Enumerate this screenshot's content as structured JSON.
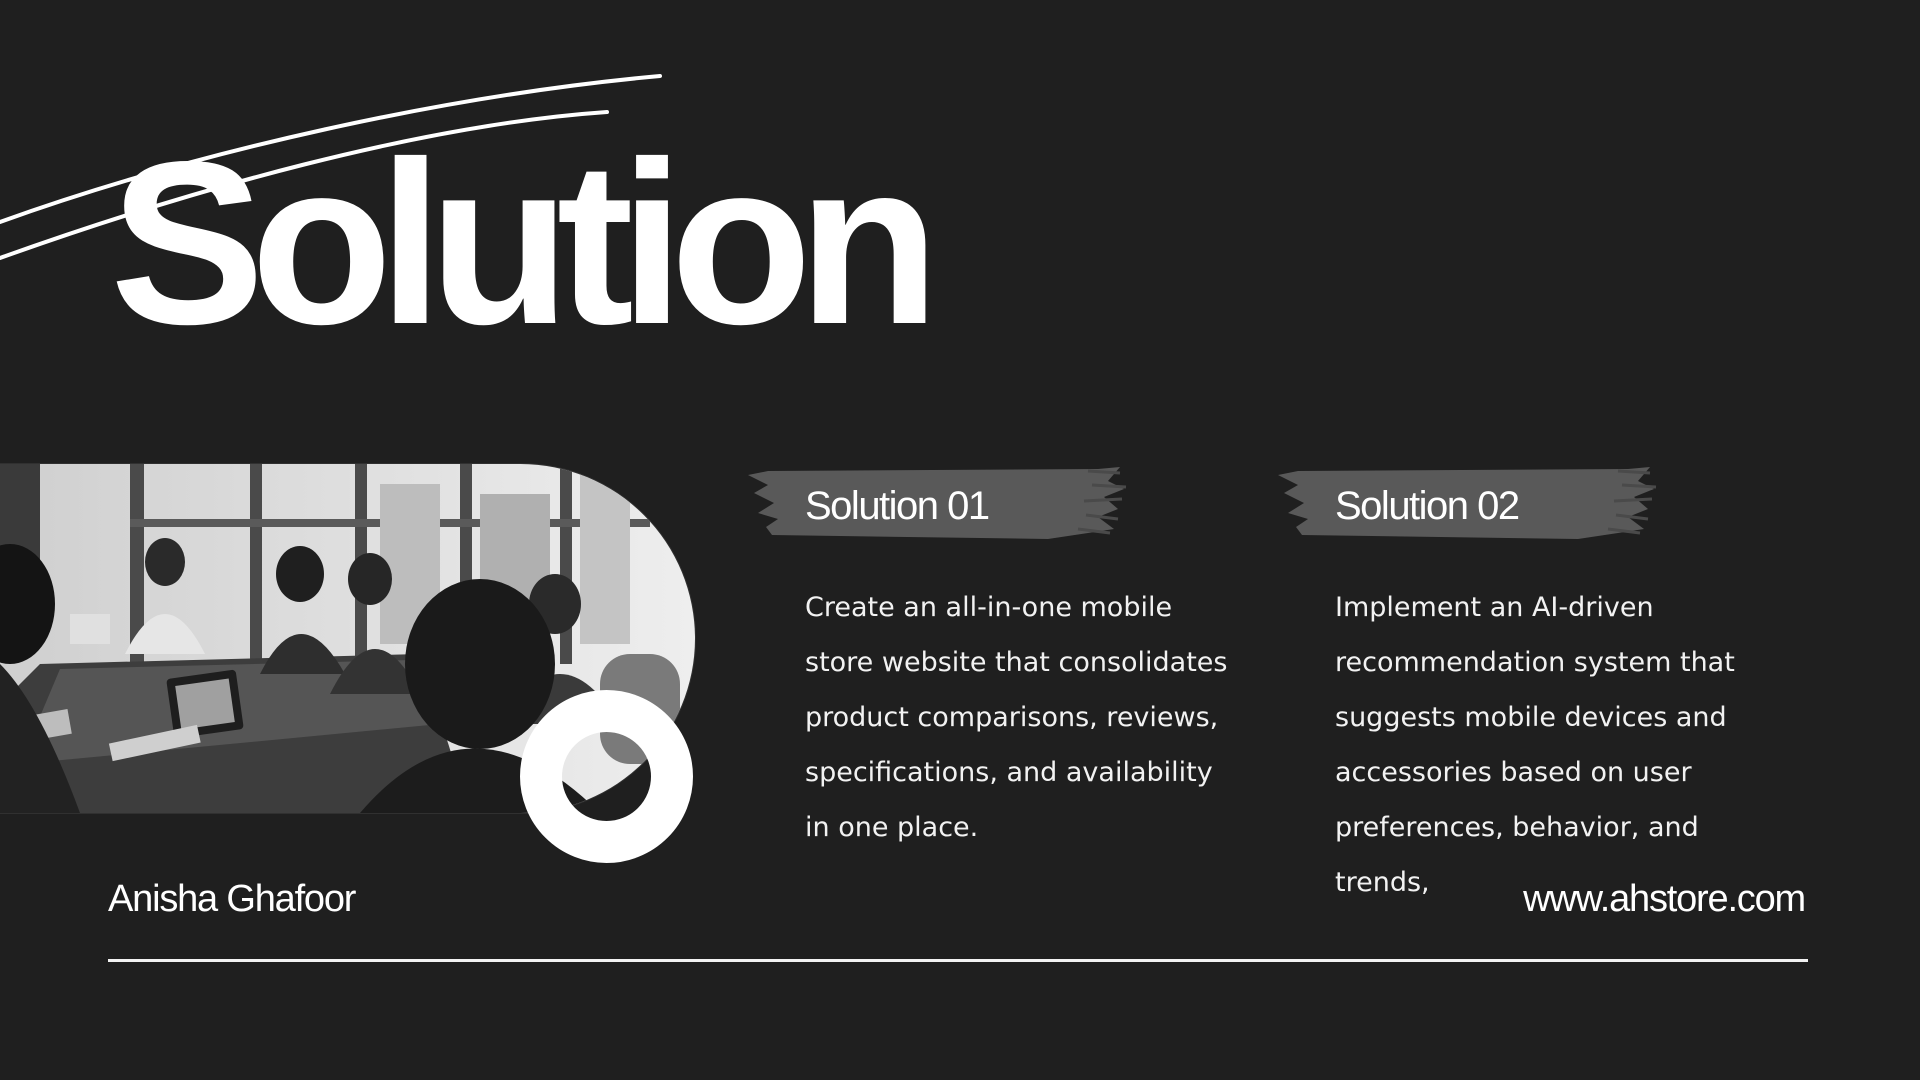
{
  "slide": {
    "title": "Solution",
    "author": "Anisha Ghafoor",
    "website": "www.ahstore.com"
  },
  "solutions": [
    {
      "heading": "Solution 01",
      "text": "Create an all-in-one mobile store website that consolidates product comparisons, reviews, specifications, and availability in one place."
    },
    {
      "heading": "Solution 02",
      "text": "Implement an AI-driven recommendation system that suggests mobile devices and accessories based on user preferences, behavior, and trends,"
    }
  ],
  "colors": {
    "background": "#1f1f1f",
    "foreground": "#ffffff",
    "brush": "#595959"
  }
}
